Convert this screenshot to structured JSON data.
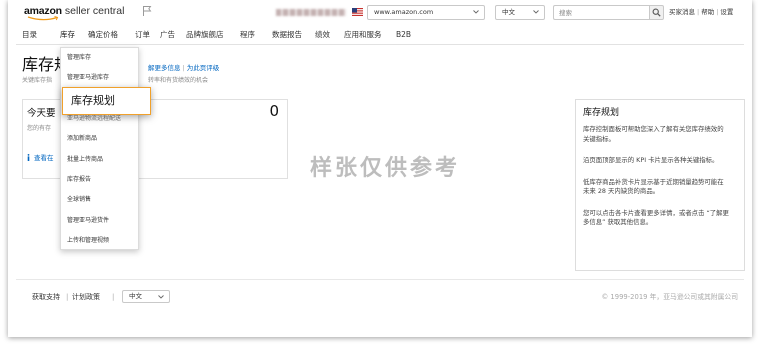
{
  "colors": {
    "accent_orange": "#f0a02a",
    "link_blue": "#0066c0",
    "text_dark": "#333333",
    "text_muted": "#888888",
    "watermark_gray": "#bdbdbd",
    "border_gray": "#dddddd"
  },
  "topbar": {
    "logo": {
      "brand": "amazon",
      "product": "seller central",
      "smile_icon": "amazon-smile-icon"
    },
    "flag_icon": "flag-icon",
    "marketplace": {
      "flag_icon": "us-flag-icon",
      "value": "www.amazon.com",
      "dropdown_icon": "chevron-down-icon"
    },
    "language": {
      "value": "中文",
      "dropdown_icon": "chevron-down-icon"
    },
    "search": {
      "placeholder": "搜索",
      "button_icon": "search-icon"
    },
    "links": [
      "买家消息",
      "帮助",
      "设置"
    ],
    "separator": "|"
  },
  "nav": {
    "items": [
      "目录",
      "库存",
      "确定价格",
      "订单",
      "广告",
      "品牌旗舰店",
      "程序",
      "数据报告",
      "绩效",
      "应用和服务",
      "B2B"
    ],
    "active_index": 1
  },
  "dropdown": {
    "items": [
      "管理库存",
      "管理亚马逊库存",
      "库存规划",
      "亚马逊物流远程配送",
      "添加新商品",
      "批量上传商品",
      "库存报告",
      "全球销售",
      "管理亚马逊货件",
      "上传和管理视频"
    ],
    "highlighted_index": 2
  },
  "page": {
    "title": "库存规",
    "subtitle_left": "关键库存指",
    "links": [
      "解更多信息",
      "为此页评级"
    ],
    "separator": "|",
    "subtitle_right": "转率和有货绩效的机会"
  },
  "card": {
    "title": "今天要",
    "subtitle": "您的有存",
    "count": "0",
    "info_icon": "info-icon",
    "link": "查看在"
  },
  "watermark": "样张仅供参考",
  "help_panel": {
    "title": "库存规划",
    "paragraphs": [
      "库存控制面板可帮助您深入了解有关您库存绩效的关键指标。",
      "沿页面顶部显示的 KPI 卡片显示各种关键指标。",
      "低库存商品补货卡片显示基于近期销量趋势可能在未来 28 天内缺货的商品。",
      "您可以点击各卡片查看更多详情，或者点击 “了解更多信息” 获取其他信息。"
    ]
  },
  "footer": {
    "links": [
      "获取支持",
      "计划政策"
    ],
    "separator": "|",
    "language": {
      "value": "中文",
      "dropdown_icon": "chevron-down-icon"
    },
    "copyright": "© 1999-2019 年，亚马逊公司或其附属公司"
  }
}
